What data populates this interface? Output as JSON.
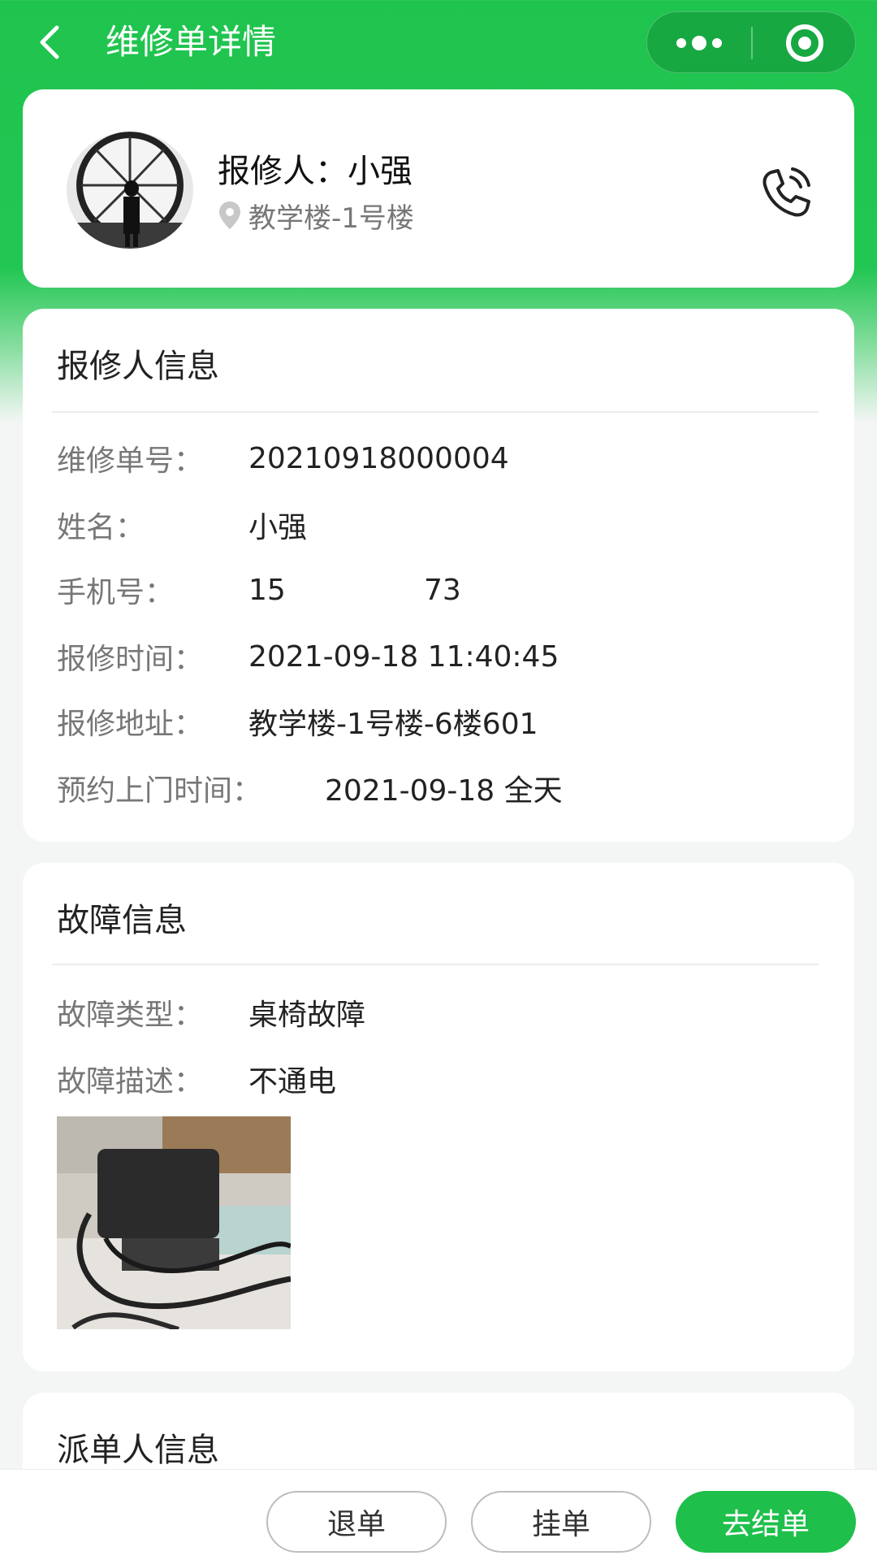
{
  "header": {
    "title": "维修单详情"
  },
  "reporter": {
    "name_line": "报修人：小强",
    "location": "教学楼-1号楼"
  },
  "reporter_info": {
    "section_title": "报修人信息",
    "order_no_label": "维修单号：",
    "order_no": "20210918000004",
    "name_label": "姓名：",
    "name": "小强",
    "phone_label": "手机号：",
    "phone_prefix": "15",
    "phone_suffix": "73",
    "time_label": "报修时间：",
    "time": "2021-09-18 11:40:45",
    "address_label": "报修地址：",
    "address": "教学楼-1号楼-6楼601",
    "appoint_label": "预约上门时间：",
    "appoint": "2021-09-18 全天"
  },
  "fault_info": {
    "section_title": "故障信息",
    "type_label": "故障类型：",
    "type": "桌椅故障",
    "desc_label": "故障描述：",
    "desc": "不通电"
  },
  "dispatch_info": {
    "section_title": "派单人信息"
  },
  "actions": {
    "return_label": "退单",
    "hold_label": "挂单",
    "complete_label": "去结单"
  },
  "colors": {
    "brand_green": "#1fbf4b"
  }
}
